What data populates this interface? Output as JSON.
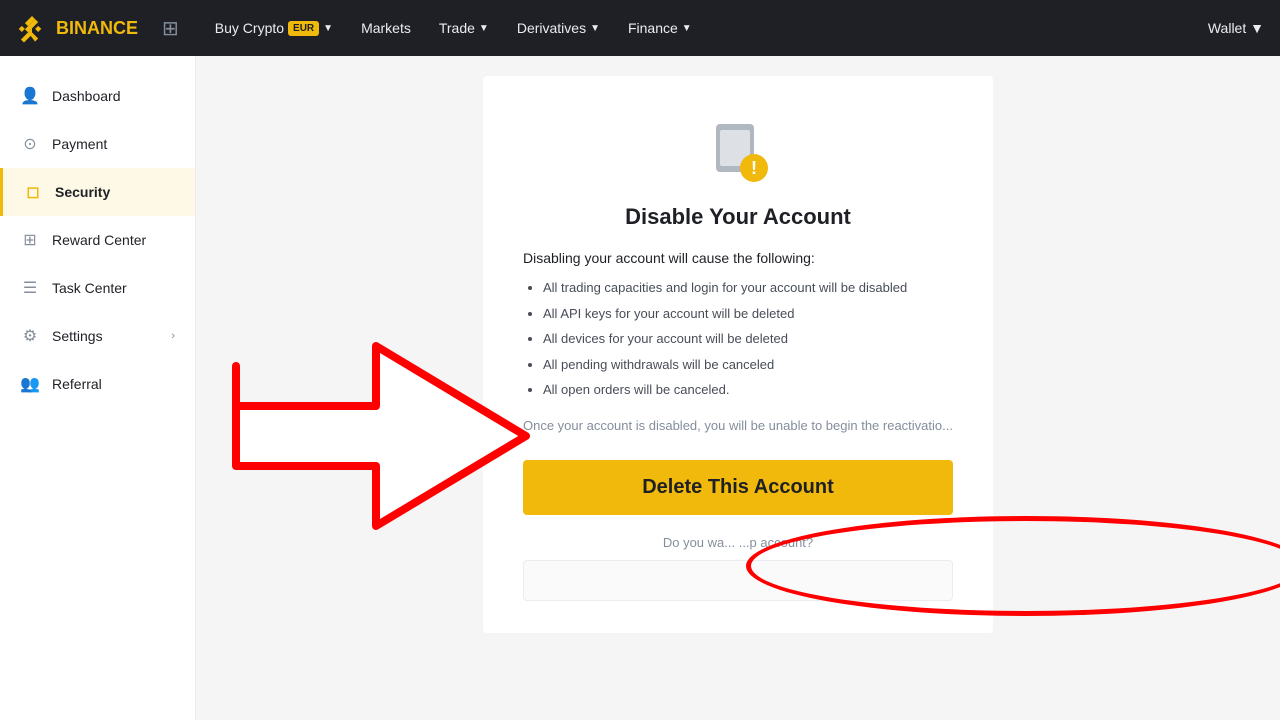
{
  "topnav": {
    "logo_text": "BINANCE",
    "grid_icon": "⊞",
    "links": [
      {
        "label": "Buy Crypto",
        "badge": "EUR",
        "has_chevron": true
      },
      {
        "label": "Markets",
        "has_chevron": false
      },
      {
        "label": "Trade",
        "has_chevron": true
      },
      {
        "label": "Derivatives",
        "has_chevron": true
      },
      {
        "label": "Finance",
        "has_chevron": true
      }
    ],
    "wallet_label": "Wallet",
    "chevron": "▼"
  },
  "sidebar": {
    "items": [
      {
        "label": "Dashboard",
        "icon": "👤",
        "active": false
      },
      {
        "label": "Payment",
        "icon": "💰",
        "active": false
      },
      {
        "label": "Security",
        "icon": "🛡",
        "active": true
      },
      {
        "label": "Reward Center",
        "icon": "🎁",
        "active": false
      },
      {
        "label": "Task Center",
        "icon": "📋",
        "active": false
      },
      {
        "label": "Settings",
        "icon": "⚙",
        "active": false,
        "has_chevron": true
      },
      {
        "label": "Referral",
        "icon": "👥",
        "active": false
      }
    ]
  },
  "modal": {
    "title": "Disable Your Account",
    "subtitle": "Disabling your account will cause the following:",
    "list_items": [
      "All trading capacities and login for your account will be disabled",
      "All API keys for your account will be deleted",
      "All devices for your account will be deleted",
      "All pending withdrawals will be canceled",
      "All open orders will be canceled."
    ],
    "note": "Once your account is disabled, you will be unable to begin the reactivatio...",
    "delete_button_label": "Delete This Account",
    "question_label": "Do you wa... ...p account?",
    "input_placeholder": ""
  }
}
